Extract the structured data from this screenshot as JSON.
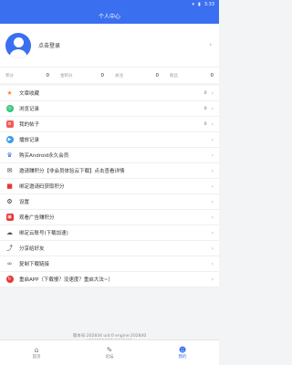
{
  "status_bar": {
    "time": "3:33",
    "wifi_icon": "wifi-icon",
    "battery_icon": "battery-icon"
  },
  "header": {
    "title": "个人中心"
  },
  "profile": {
    "login_label": "点击登录"
  },
  "stats": [
    {
      "label": "积分",
      "value": "0"
    },
    {
      "label": "金积分",
      "value": "0"
    },
    {
      "label": "关注",
      "value": "0"
    },
    {
      "label": "粉丝",
      "value": "0"
    }
  ],
  "menu": [
    {
      "icon": "star-icon",
      "label": "文章收藏",
      "count": "0",
      "color": "#ff8a3d"
    },
    {
      "icon": "clock-icon",
      "label": "浏览记录",
      "count": "0",
      "color": "#2ec47a"
    },
    {
      "icon": "posts-icon",
      "label": "我的帖子",
      "count": "0",
      "color": "#f25a5a"
    },
    {
      "icon": "play-icon",
      "label": "播放记录",
      "count": "",
      "color": "#3a9bf0"
    },
    {
      "icon": "crown-icon",
      "label": "购买Android永久会员",
      "count": "",
      "color": "#3a6ff0"
    },
    {
      "icon": "mail-icon",
      "label": "邀请赚积分【非会员体验云下载】点击查看详情",
      "count": "",
      "color": "#333333"
    },
    {
      "icon": "gift-icon",
      "label": "绑定邀请码获取积分",
      "count": "",
      "color": "#e53935"
    },
    {
      "icon": "gear-icon",
      "label": "设置",
      "count": "",
      "color": "#222222"
    },
    {
      "icon": "ad-icon",
      "label": "观看广告赚积分",
      "count": "",
      "color": "#e53935"
    },
    {
      "icon": "cloud-icon",
      "label": "绑定云账号(下载加速)",
      "count": "",
      "color": "#555555"
    },
    {
      "icon": "share-icon",
      "label": "分享给好友",
      "count": "",
      "color": "#555555"
    },
    {
      "icon": "link-icon",
      "label": "复制下载链接",
      "count": "",
      "color": "#555555"
    },
    {
      "icon": "restart-icon",
      "label": "重启APP（下载慢？没速度？重启大法~）",
      "count": "",
      "color": "#e53935"
    }
  ],
  "version": {
    "line1": "版本号:202834 uid:0 engine:202840",
    "line2": "4010158C9FA9868989"
  },
  "tabs": [
    {
      "icon": "home-icon",
      "label": "首页"
    },
    {
      "icon": "forum-icon",
      "label": "论坛"
    },
    {
      "icon": "profile-icon",
      "label": "我的"
    }
  ]
}
